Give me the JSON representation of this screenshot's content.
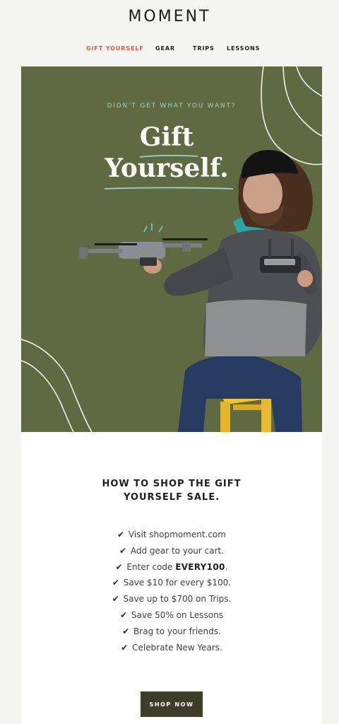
{
  "brand": {
    "logo": "MOMENT"
  },
  "nav": {
    "items": [
      {
        "label": "GIFT YOURSELF",
        "active": true
      },
      {
        "label": "GEAR"
      },
      {
        "label": "TRIPS"
      },
      {
        "label": "LESSONS"
      }
    ]
  },
  "hero": {
    "eyebrow": "DIDN'T GET WHAT YOU WANT?",
    "headline_line1": "Gift",
    "headline_line2": "Yourself.",
    "image_description": "man with beard and beanie sitting on a yellow stool holding a drone and a remote controller",
    "colors": {
      "background": "#5f6a43",
      "eyebrow": "#9fd3c7",
      "headline": "#fbfbf7",
      "underline": "#9fd3c7"
    }
  },
  "content": {
    "heading_line1": "HOW TO SHOP THE GIFT",
    "heading_line2": "YOURSELF SALE.",
    "steps": [
      {
        "text": "Visit shopmoment.com"
      },
      {
        "text": "Add gear to your cart."
      },
      {
        "prefix": "Enter code",
        "code": "EVERY100",
        "suffix": "."
      },
      {
        "text": "Save $10 for every $100."
      },
      {
        "text": "Save up to $700 on Trips."
      },
      {
        "text": "Save 50% on Lessons"
      },
      {
        "text": "Brag to your friends."
      },
      {
        "text": "Celebrate New Years."
      }
    ],
    "check_glyph": "✔",
    "cta_label": "SHOP NOW",
    "cta_color": "#3d3d29"
  }
}
